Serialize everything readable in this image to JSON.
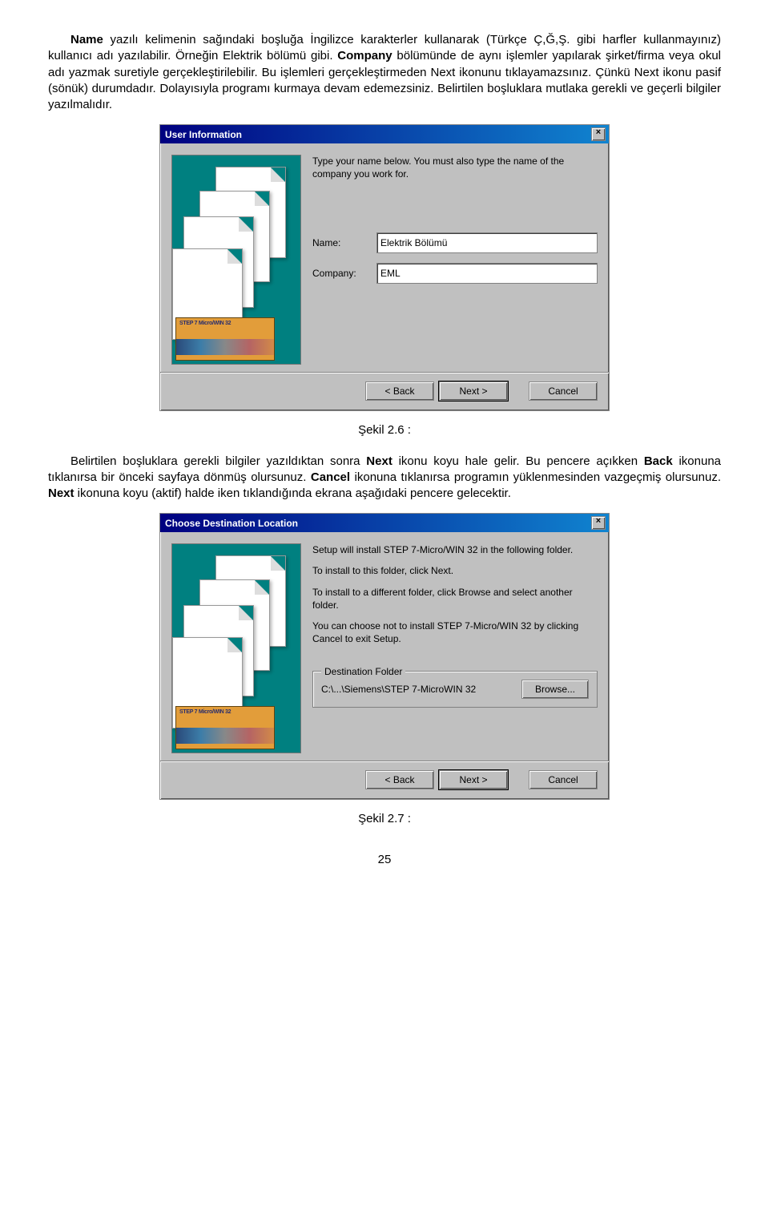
{
  "para1": {
    "seg1_bold": "Name",
    "seg1": " yazılı kelimenin sağındaki boşluğa İngilizce karakterler kullanarak (Türkçe Ç,Ğ,Ş. gibi harfler kullanmayınız) kullanıcı adı yazılabilir. Örneğin Elektrik bölümü gibi. ",
    "seg2_bold": "Company",
    "seg2": " bölümünde de aynı işlemler yapılarak şirket/firma veya okul adı yazmak suretiyle gerçekleştirilebilir.  Bu işlemleri gerçekleştirmeden Next ikonunu tıklayamazsınız. Çünkü Next ikonu pasif (sönük) durumdadır. Dolayısıyla programı kurmaya devam edemezsiniz. Belirtilen boşluklara mutlaka gerekli  ve geçerli bilgiler yazılmalıdır."
  },
  "dialog1": {
    "title": "User Information",
    "desc": "Type your name below. You must also type the name of the company you work for.",
    "name_label": "Name:",
    "name_value": "Elektrik Bölümü",
    "company_label": "Company:",
    "company_value": "EML",
    "back": "< Back",
    "next": "Next >",
    "cancel": "Cancel"
  },
  "caption1": "Şekil 2.6 :",
  "para2": {
    "seg1": "Belirtilen boşluklara gerekli bilgiler yazıldıktan sonra ",
    "seg2_bold": "Next",
    "seg3": " ikonu koyu hale gelir. Bu pencere  açıkken ",
    "seg4_bold": "Back",
    "seg5": " ikonuna tıklanırsa bir önceki sayfaya dönmüş olursunuz. ",
    "seg6_bold": "Cancel",
    "seg7": " ikonuna tıklanırsa  programın yüklenmesinden vazgeçmiş  olursunuz. ",
    "seg8_bold": "Next",
    "seg9": " ikonuna  koyu (aktif) halde iken tıklandığında  ekrana aşağıdaki pencere gelecektir."
  },
  "dialog2": {
    "title": "Choose Destination Location",
    "desc1": "Setup will install STEP 7-Micro/WIN 32 in the following folder.",
    "desc2": "To install to this folder, click Next.",
    "desc3": "To install to a different folder, click Browse and select another folder.",
    "desc4": "You can choose not to install STEP 7-Micro/WIN 32 by clicking Cancel to exit Setup.",
    "group_label": "Destination Folder",
    "path": "C:\\...\\Siemens\\STEP 7-MicroWIN 32",
    "browse": "Browse...",
    "back": "< Back",
    "next": "Next >",
    "cancel": "Cancel"
  },
  "caption2": "Şekil 2.7 :",
  "page": "25"
}
